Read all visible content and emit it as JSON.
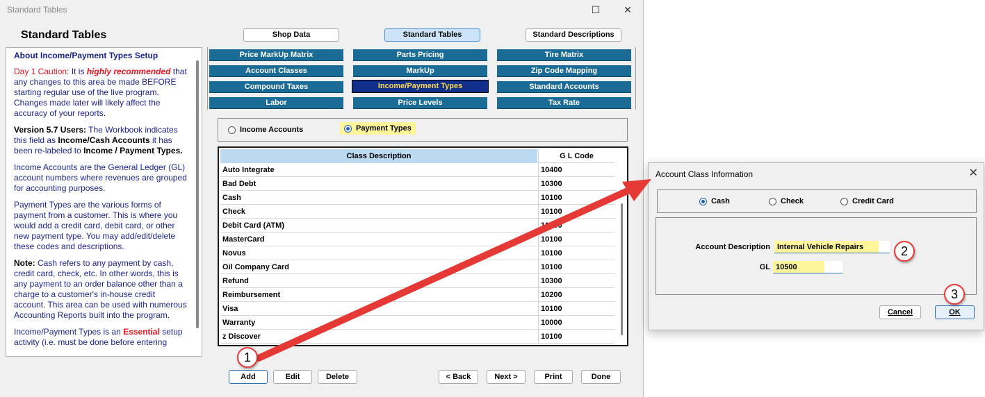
{
  "window": {
    "title": "Standard Tables",
    "heading": "Standard Tables",
    "maximize_glyph": "☐",
    "close_glyph": "✕"
  },
  "top_buttons": [
    "Shop Data",
    "Standard Tables",
    "Standard Descriptions"
  ],
  "tabs": [
    [
      "Price MarkUp Matrix",
      "Parts Pricing",
      "Tire Matrix"
    ],
    [
      "Account Classes",
      "MarkUp",
      "Zip Code Mapping"
    ],
    [
      "Compound Taxes",
      "Income/Payment Types",
      "Standard Accounts"
    ],
    [
      "Labor",
      "Price Levels",
      "Tax Rate"
    ]
  ],
  "selected_tab": "Income/Payment Types",
  "help": {
    "heading": "About Income/Payment Types Setup",
    "p1_a": "Day 1 Caution",
    "p1_b": ": It is ",
    "p1_c": "highly recommended",
    "p1_d": " that any changes to this area be made BEFORE starting regular use of the live program. Changes made later will likely affect the accuracy of your reports.",
    "p2_a": "Version 5.7 Users:",
    "p2_b": " The Workbook indicates this field as ",
    "p2_c": "Income/Cash Accounts",
    "p2_d": " it has been re-labeled to ",
    "p2_e": "Income / Payment Types.",
    "p3_a": "Income Accounts",
    "p3_b": " are the General Ledger (GL) account numbers where revenues are grouped for accounting purposes.",
    "p4_a": "Payment Types",
    "p4_b": " are the various forms of payment from a customer. This is where you would add a credit card, debit card, or other new payment type. You may add/edit/delete these codes and descriptions.",
    "p5_a": "Note:",
    "p5_b": " Cash refers to any payment by cash, credit card, check, etc. In other words, this is any payment to an order balance other than a charge to a customer's in-house credit account. This area can be used with numerous Accounting Reports built into the program.",
    "p6_a": "Income/Payment Types is an ",
    "p6_b": "Essential",
    "p6_c": " setup activity (i.e. must be done before entering"
  },
  "radio": {
    "income_label": "Income Accounts",
    "payment_label": "Payment Types",
    "selected": "Payment Types"
  },
  "table": {
    "headers": [
      "Class Description",
      "G L Code"
    ],
    "rows": [
      [
        "Auto Integrate",
        "10400"
      ],
      [
        "Bad Debt",
        "10300"
      ],
      [
        "Cash",
        "10100"
      ],
      [
        "Check",
        "10100"
      ],
      [
        "Debit Card (ATM)",
        "10100"
      ],
      [
        "MasterCard",
        "10100"
      ],
      [
        "Novus",
        "10100"
      ],
      [
        "Oil Company Card",
        "10100"
      ],
      [
        "Refund",
        "10300"
      ],
      [
        "Reimbursement",
        "10200"
      ],
      [
        "Visa",
        "10100"
      ],
      [
        "Warranty",
        "10000"
      ],
      [
        "z Discover",
        "10100"
      ]
    ]
  },
  "bottom_buttons": [
    "Add",
    "Edit",
    "Delete",
    "< Back",
    "Next >",
    "Print",
    "Done"
  ],
  "dialog": {
    "title": "Account Class Information",
    "close_glyph": "✕",
    "radios": [
      "Cash",
      "Check",
      "Credit Card"
    ],
    "selected_radio": "Cash",
    "description_label": "Account Description",
    "description_value": "Internal Vehicle Repairs",
    "gl_label": "GL",
    "gl_value": "10500",
    "cancel_label": "Cancel",
    "ok_label": "OK"
  },
  "annotations": [
    "1",
    "2",
    "3"
  ],
  "colors": {
    "tab_blue": "#1a6b96",
    "tab_selected": "#0f2f8a",
    "highlight": "#fff59a",
    "arrow_red": "#e53935",
    "help_text": "#1a1f8a"
  }
}
